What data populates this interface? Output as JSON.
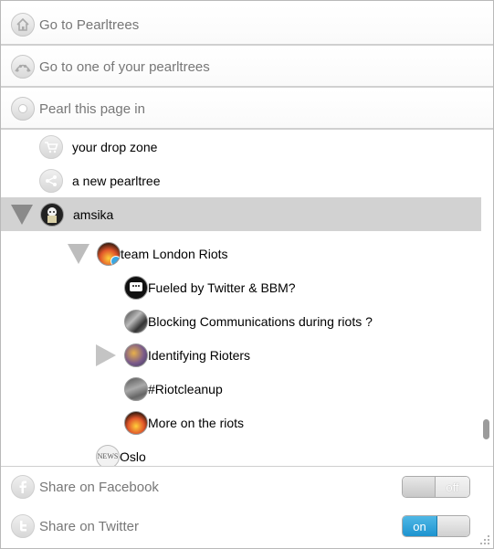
{
  "menu": {
    "go_to_pearltrees": "Go to Pearltrees",
    "go_to_one": "Go to one of your pearltrees",
    "pearl_this_page": "Pearl this page in"
  },
  "tree": {
    "drop_zone": "your drop zone",
    "new_pearltree": "a new pearltree",
    "user": "amsika",
    "team": "team London Riots",
    "children": [
      {
        "label": "Fueled by Twitter & BBM?",
        "icon": "bbm-icon"
      },
      {
        "label": "Blocking Communications during riots ?",
        "icon": "photo-icon"
      },
      {
        "label": "Identifying Rioters",
        "icon": "photo-icon"
      },
      {
        "label": "#Riotcleanup",
        "icon": "photo-icon"
      },
      {
        "label": "More on the riots",
        "icon": "fire-photo-icon"
      }
    ],
    "oslo": "Oslo",
    "oslo_icon_text": "NEWS"
  },
  "share": {
    "facebook": "Share on Facebook",
    "twitter": "Share on Twitter",
    "facebook_state": "off",
    "twitter_state": "on"
  },
  "colors": {
    "selected_row": "#d2d2d2",
    "toggle_on": "#1d93cf",
    "muted_text": "#777777"
  }
}
